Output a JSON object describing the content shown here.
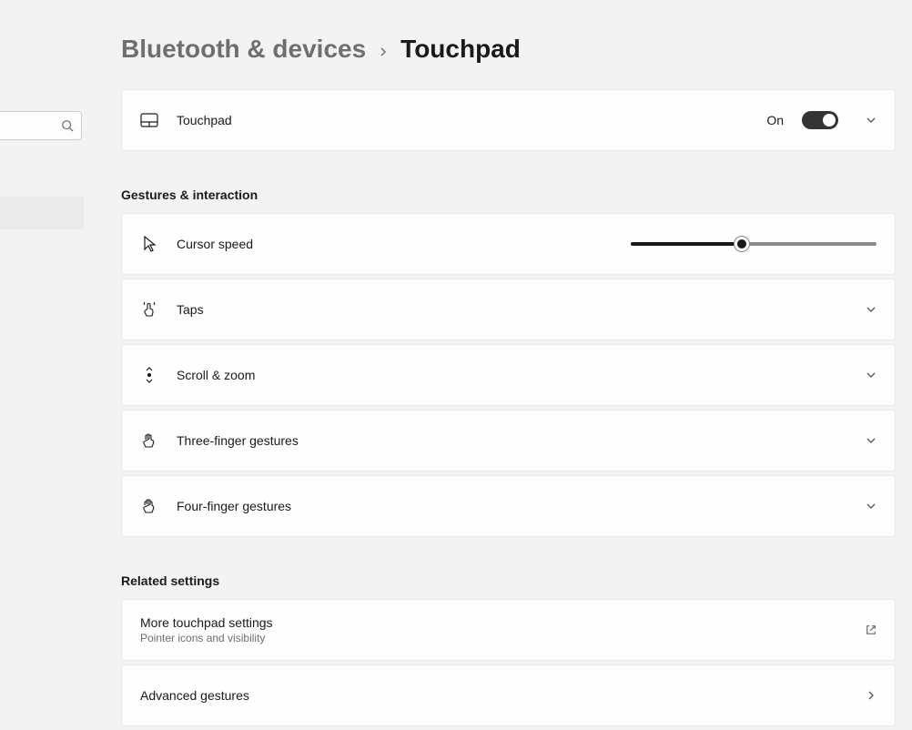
{
  "breadcrumb": {
    "parent": "Bluetooth & devices",
    "current": "Touchpad"
  },
  "touchpad": {
    "label": "Touchpad",
    "state_label": "On",
    "enabled": true
  },
  "sections": {
    "gestures_title": "Gestures & interaction",
    "related_title": "Related settings"
  },
  "cursor_speed": {
    "label": "Cursor speed",
    "value_pct": 45
  },
  "rows": {
    "taps": "Taps",
    "scroll_zoom": "Scroll & zoom",
    "three_finger": "Three-finger gestures",
    "four_finger": "Four-finger gestures"
  },
  "related": {
    "more": {
      "title": "More touchpad settings",
      "sub": "Pointer icons and visibility"
    },
    "advanced": {
      "title": "Advanced gestures"
    }
  }
}
